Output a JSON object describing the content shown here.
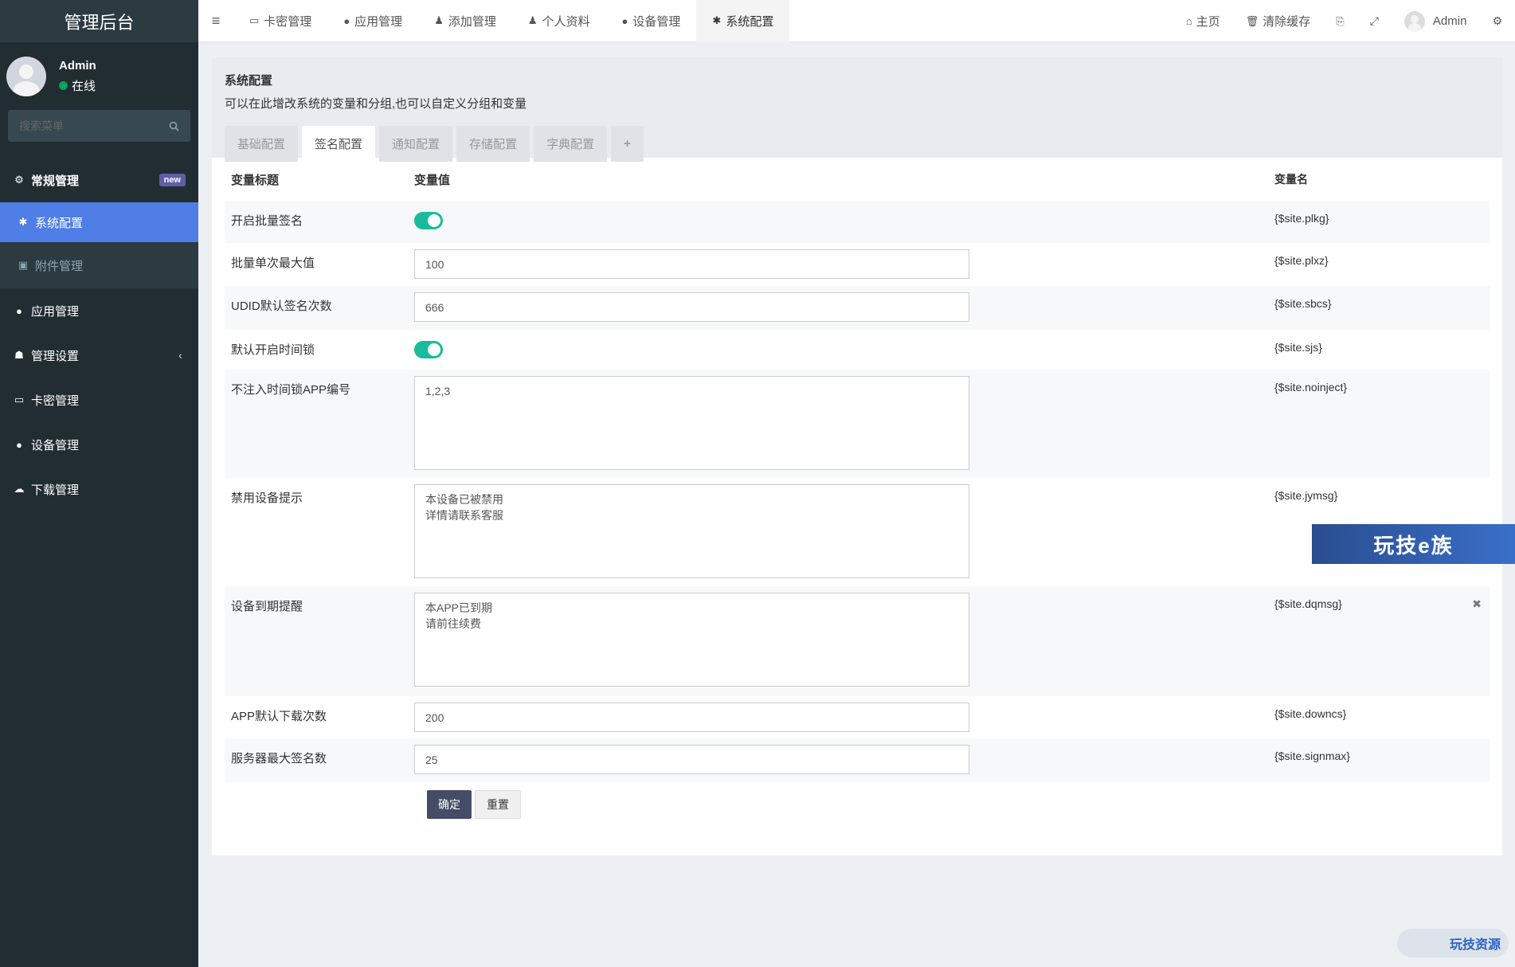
{
  "app": {
    "title": "管理后台"
  },
  "user": {
    "name": "Admin",
    "status": "在线"
  },
  "sidebar": {
    "search_placeholder": "搜索菜单",
    "items": [
      {
        "label": "常规管理",
        "icon": "cogs-icon",
        "badge": "new"
      },
      {
        "label": "系统配置",
        "icon": "gear-icon"
      },
      {
        "label": "附件管理",
        "icon": "image-icon"
      },
      {
        "label": "应用管理",
        "icon": "app-icon"
      },
      {
        "label": "管理设置",
        "icon": "users-icon"
      },
      {
        "label": "卡密管理",
        "icon": "card-icon"
      },
      {
        "label": "设备管理",
        "icon": "apple-icon"
      },
      {
        "label": "下载管理",
        "icon": "cloud-download-icon"
      }
    ]
  },
  "topnav": {
    "tabs": [
      {
        "label": "卡密管理",
        "icon": "card-icon"
      },
      {
        "label": "应用管理",
        "icon": "app-icon"
      },
      {
        "label": "添加管理",
        "icon": "user-icon"
      },
      {
        "label": "个人资料",
        "icon": "user-icon"
      },
      {
        "label": "设备管理",
        "icon": "apple-icon"
      },
      {
        "label": "系统配置",
        "icon": "gear-icon"
      }
    ],
    "home_label": "主页",
    "clear_cache_label": "清除缓存",
    "user_label": "Admin"
  },
  "panel": {
    "title": "系统配置",
    "description": "可以在此增改系统的变量和分组,也可以自定义分组和变量",
    "tabs": [
      "基础配置",
      "签名配置",
      "通知配置",
      "存储配置",
      "字典配置",
      "+"
    ],
    "active_tab": "签名配置"
  },
  "table": {
    "headers": [
      "变量标题",
      "变量值",
      "变量名"
    ],
    "rows": [
      {
        "title": "开启批量签名",
        "type": "switch",
        "value": "on",
        "var": "{$site.plkg}"
      },
      {
        "title": "批量单次最大值",
        "type": "input",
        "value": "100",
        "var": "{$site.plxz}"
      },
      {
        "title": "UDID默认签名次数",
        "type": "input",
        "value": "666",
        "var": "{$site.sbcs}"
      },
      {
        "title": "默认开启时间锁",
        "type": "switch",
        "value": "on",
        "var": "{$site.sjs}"
      },
      {
        "title": "不注入时间锁APP编号",
        "type": "textarea",
        "value": "1,2,3",
        "var": "{$site.noinject}"
      },
      {
        "title": "禁用设备提示",
        "type": "textarea",
        "value": "本设备已被禁用\n详情请联系客服",
        "var": "{$site.jymsg}"
      },
      {
        "title": "设备到期提醒",
        "type": "textarea",
        "value": "本APP已到期\n请前往续费",
        "var": "{$site.dqmsg}"
      },
      {
        "title": "APP默认下载次数",
        "type": "input",
        "value": "200",
        "var": "{$site.downcs}"
      },
      {
        "title": "服务器最大签名数",
        "type": "input",
        "value": "25",
        "var": "{$site.signmax}"
      }
    ]
  },
  "buttons": {
    "submit": "确定",
    "reset": "重置"
  },
  "watermarks": {
    "banner": "玩技e族",
    "corner": "玩技资源"
  },
  "colors": {
    "accent": "#4f7ee6",
    "switch_on": "#18bc9c",
    "sidebar_bg": "#222d32"
  }
}
